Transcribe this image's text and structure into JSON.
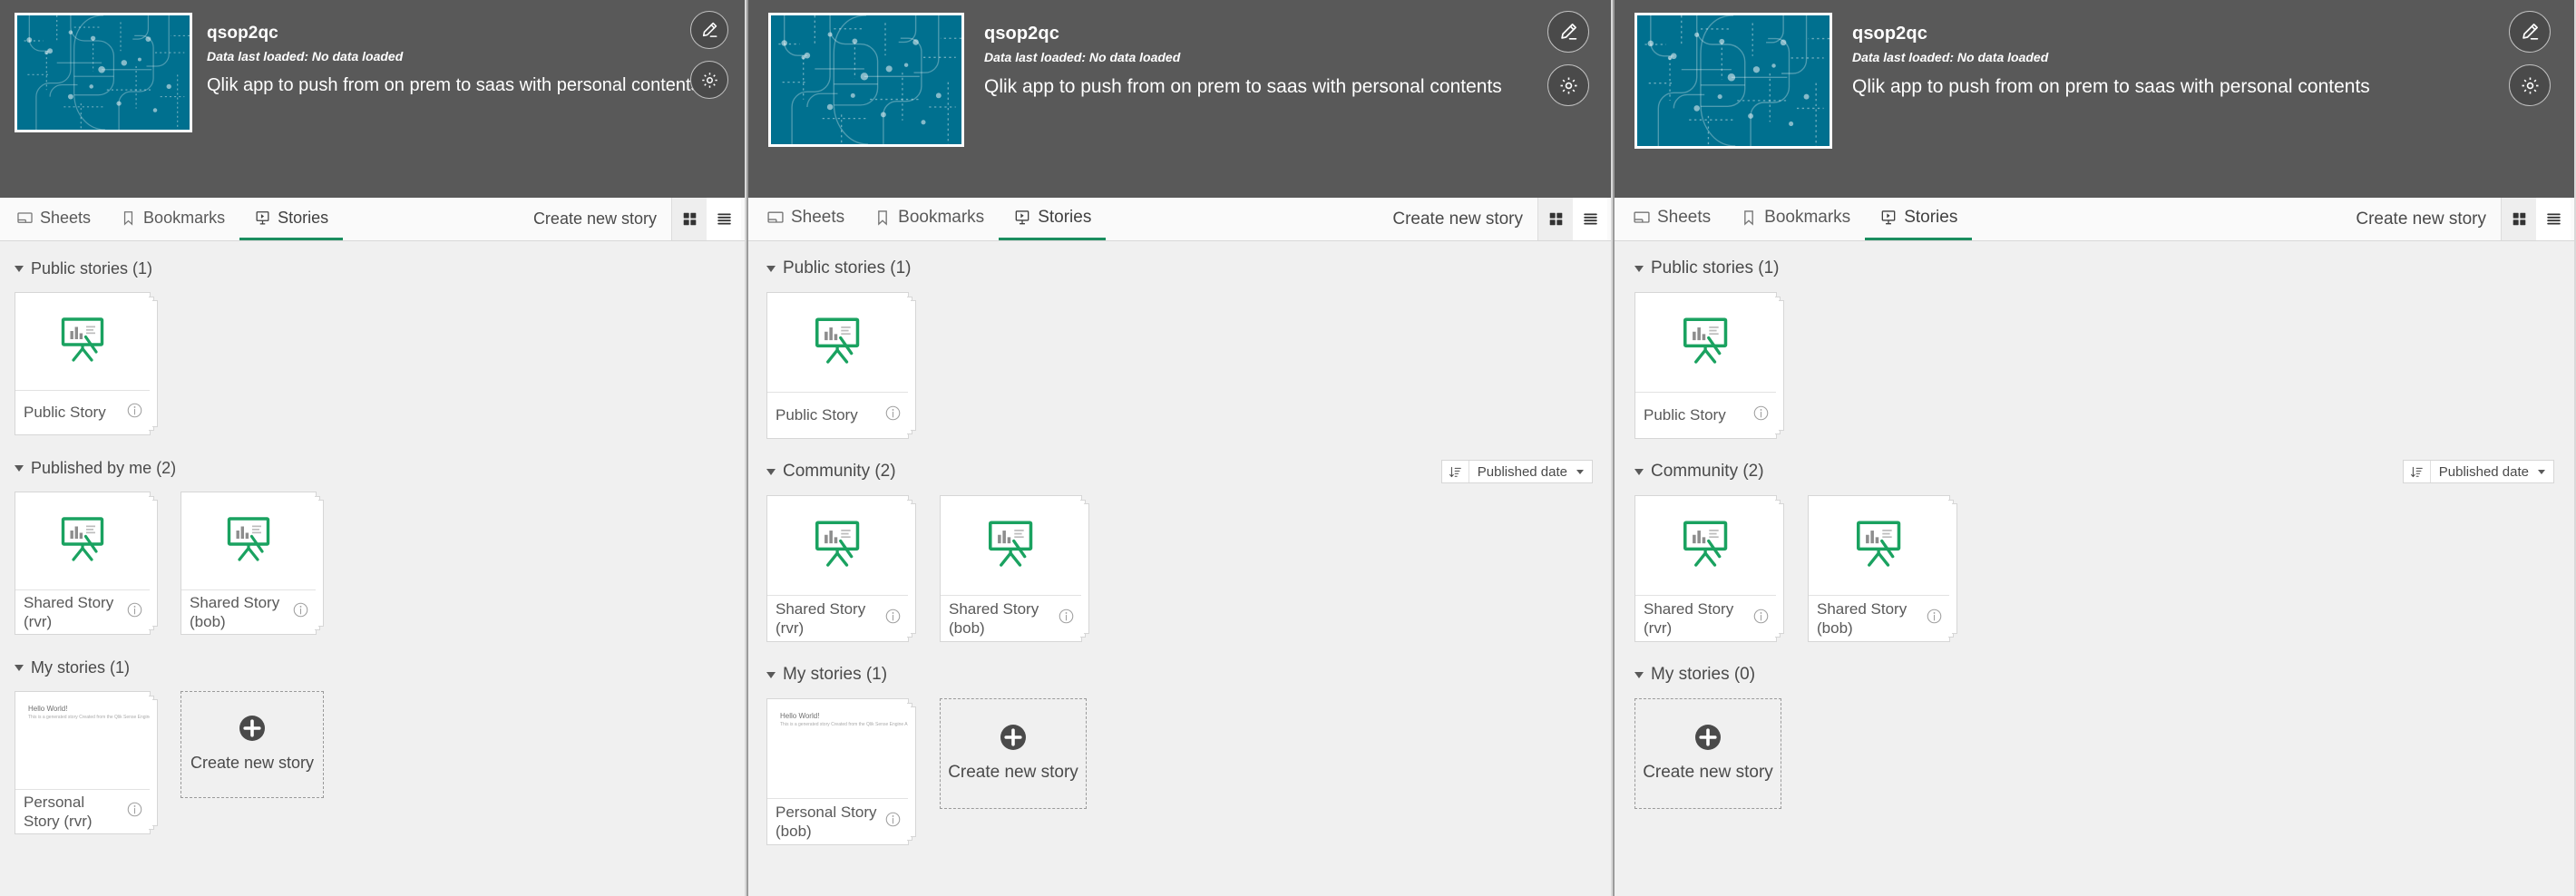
{
  "app": {
    "title": "qsop2qc",
    "last_loaded": "Data last loaded: No data loaded",
    "description": "Qlik app to push from on prem to saas with personal contents",
    "thumbnail_color": "#00708f",
    "edit_button_label": "Edit app",
    "settings_button_label": "App settings"
  },
  "tabs": [
    {
      "label": "Sheets",
      "icon": "sheets-icon",
      "active": false
    },
    {
      "label": "Bookmarks",
      "icon": "bookmark-icon",
      "active": false
    },
    {
      "label": "Stories",
      "icon": "story-icon",
      "active": true
    }
  ],
  "toolbar": {
    "create_label": "Create new story",
    "grid_view_label": "Grid view",
    "list_view_label": "List view",
    "active_view": "grid"
  },
  "sort": {
    "icon": "sort-descending-icon",
    "value": "Published date"
  },
  "colors": {
    "accent_green": "#1a8d5f",
    "story_icon_green": "#1aa260",
    "header_gray": "#595959",
    "content_gray": "#f0f0f0"
  },
  "panels": [
    {
      "id": "panel-rvr",
      "sections": [
        {
          "id": "public-stories",
          "title": "Public stories (1)",
          "has_sort": false,
          "cards": [
            {
              "name": "Public Story",
              "thumb": "easel",
              "stacked": true
            }
          ],
          "create_card": false
        },
        {
          "id": "published-by-me",
          "title": "Published by me (2)",
          "has_sort": false,
          "cards": [
            {
              "name": "Shared Story (rvr)",
              "thumb": "easel",
              "stacked": true
            },
            {
              "name": "Shared Story (bob)",
              "thumb": "easel",
              "stacked": true
            }
          ],
          "create_card": false
        },
        {
          "id": "my-stories",
          "title": "My stories (1)",
          "has_sort": false,
          "cards": [
            {
              "name": "Personal Story (rvr)",
              "thumb": "hello-world",
              "stacked": true,
              "thumb_title": "Hello World!",
              "thumb_sub": "This is a generated  story\nCreated from the Qlik Sense Engine API"
            }
          ],
          "create_card": true,
          "create_label": "Create new story"
        }
      ]
    },
    {
      "id": "panel-bob",
      "sections": [
        {
          "id": "public-stories",
          "title": "Public stories (1)",
          "has_sort": false,
          "cards": [
            {
              "name": "Public Story",
              "thumb": "easel",
              "stacked": true
            }
          ],
          "create_card": false
        },
        {
          "id": "community",
          "title": "Community (2)",
          "has_sort": true,
          "cards": [
            {
              "name": "Shared Story (rvr)",
              "thumb": "easel",
              "stacked": true
            },
            {
              "name": "Shared Story (bob)",
              "thumb": "easel",
              "stacked": true
            }
          ],
          "create_card": false
        },
        {
          "id": "my-stories",
          "title": "My stories (1)",
          "has_sort": false,
          "cards": [
            {
              "name": "Personal Story (bob)",
              "thumb": "hello-world",
              "stacked": true,
              "thumb_title": "Hello World!",
              "thumb_sub": "This is a generated  story\nCreated from the Qlik Sense Engine API"
            }
          ],
          "create_card": true,
          "create_label": "Create new story"
        }
      ]
    },
    {
      "id": "panel-third",
      "sections": [
        {
          "id": "public-stories",
          "title": "Public stories (1)",
          "has_sort": false,
          "cards": [
            {
              "name": "Public Story",
              "thumb": "easel",
              "stacked": true
            }
          ],
          "create_card": false
        },
        {
          "id": "community",
          "title": "Community (2)",
          "has_sort": true,
          "cards": [
            {
              "name": "Shared Story (rvr)",
              "thumb": "easel",
              "stacked": true
            },
            {
              "name": "Shared Story (bob)",
              "thumb": "easel",
              "stacked": true
            }
          ],
          "create_card": false
        },
        {
          "id": "my-stories",
          "title": "My stories (0)",
          "has_sort": false,
          "cards": [],
          "create_card": true,
          "create_label": "Create new story"
        }
      ]
    }
  ]
}
